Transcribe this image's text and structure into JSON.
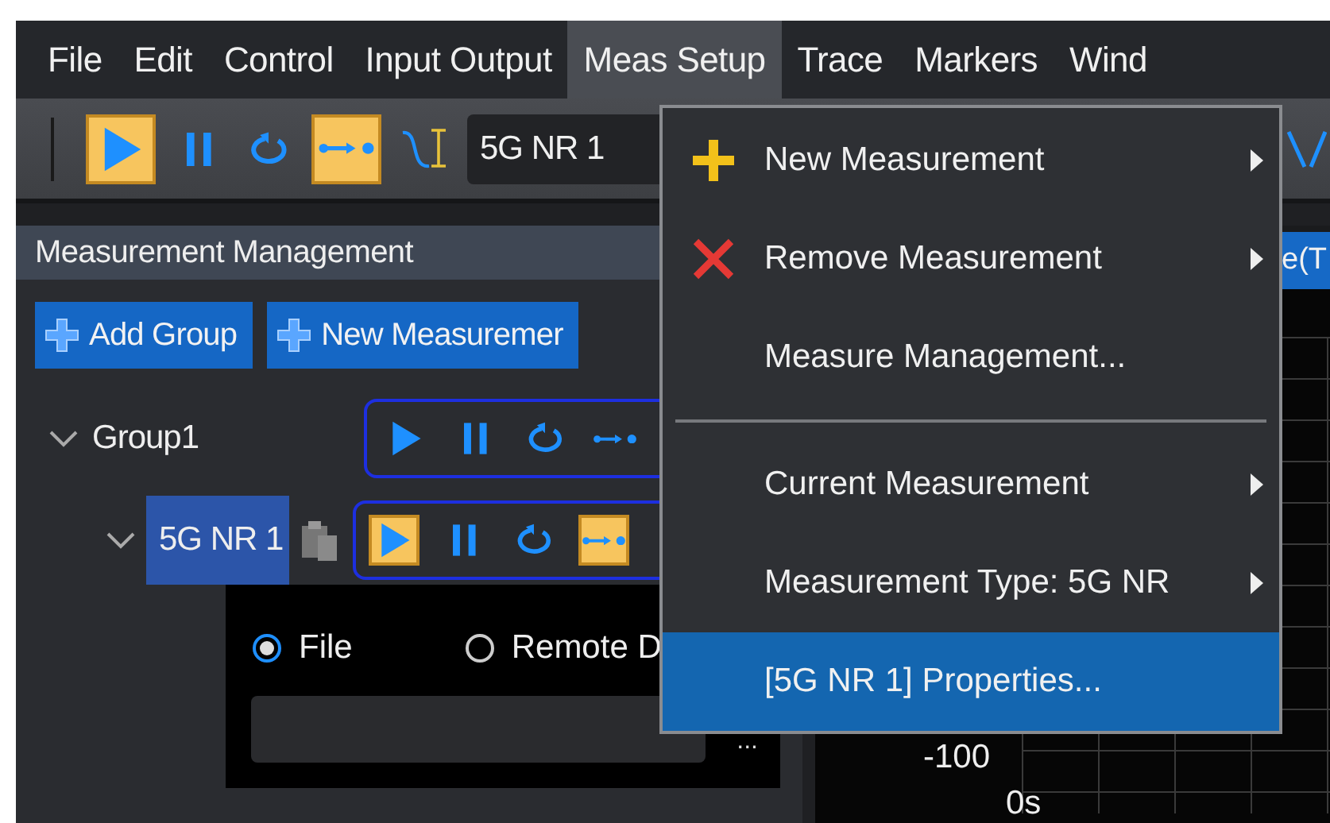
{
  "menubar": [
    {
      "label": "File",
      "selected": false
    },
    {
      "label": "Edit",
      "selected": false
    },
    {
      "label": "Control",
      "selected": false
    },
    {
      "label": "Input Output",
      "selected": false
    },
    {
      "label": "Meas Setup",
      "selected": true
    },
    {
      "label": "Trace",
      "selected": false
    },
    {
      "label": "Markers",
      "selected": false
    },
    {
      "label": "Wind",
      "selected": false
    }
  ],
  "toolbar": {
    "buttons": [
      {
        "kind": "play",
        "active": true
      },
      {
        "kind": "pause",
        "active": false
      },
      {
        "kind": "loop",
        "active": false
      },
      {
        "kind": "step",
        "active": true
      },
      {
        "kind": "trace",
        "active": false
      }
    ],
    "measurement_field": "5G NR 1"
  },
  "measurement_panel": {
    "title": "Measurement Management",
    "buttons": [
      "Add Group",
      "New Measuremer"
    ],
    "tree": [
      {
        "label": "Group1",
        "expanded": true,
        "selected": false,
        "controls": [
          {
            "kind": "play",
            "active": false
          },
          {
            "kind": "pause",
            "active": false
          },
          {
            "kind": "loop",
            "active": false
          },
          {
            "kind": "step",
            "active": false
          }
        ],
        "children": [
          {
            "label": "5G NR 1",
            "expanded": true,
            "selected": true,
            "controls": [
              {
                "kind": "play",
                "active": true
              },
              {
                "kind": "pause",
                "active": false
              },
              {
                "kind": "loop",
                "active": false
              },
              {
                "kind": "step",
                "active": true
              }
            ],
            "source": {
              "options": [
                {
                  "label": "File",
                  "selected": true
                },
                {
                  "label": "Remote D",
                  "selected": false
                }
              ],
              "browse_button": "..."
            }
          }
        ]
      }
    ]
  },
  "trace_panel": {
    "title": "e(T",
    "y_label": "-100",
    "x_label": "0s"
  },
  "menu": {
    "items": [
      {
        "kind": "add",
        "label": "New Measurement",
        "submenu": true,
        "selected": false
      },
      {
        "kind": "remove",
        "label": "Remove Measurement",
        "submenu": true,
        "selected": false
      },
      {
        "kind": "item",
        "label": "Measure Management...",
        "submenu": false,
        "selected": false
      },
      {
        "kind": "separator"
      },
      {
        "kind": "item",
        "label": "Current Measurement",
        "submenu": true,
        "selected": false
      },
      {
        "kind": "item",
        "label": "Measurement Type: 5G NR",
        "submenu": true,
        "selected": false
      },
      {
        "kind": "item",
        "label": "[5G NR 1] Properties...",
        "submenu": false,
        "selected": true
      }
    ]
  }
}
